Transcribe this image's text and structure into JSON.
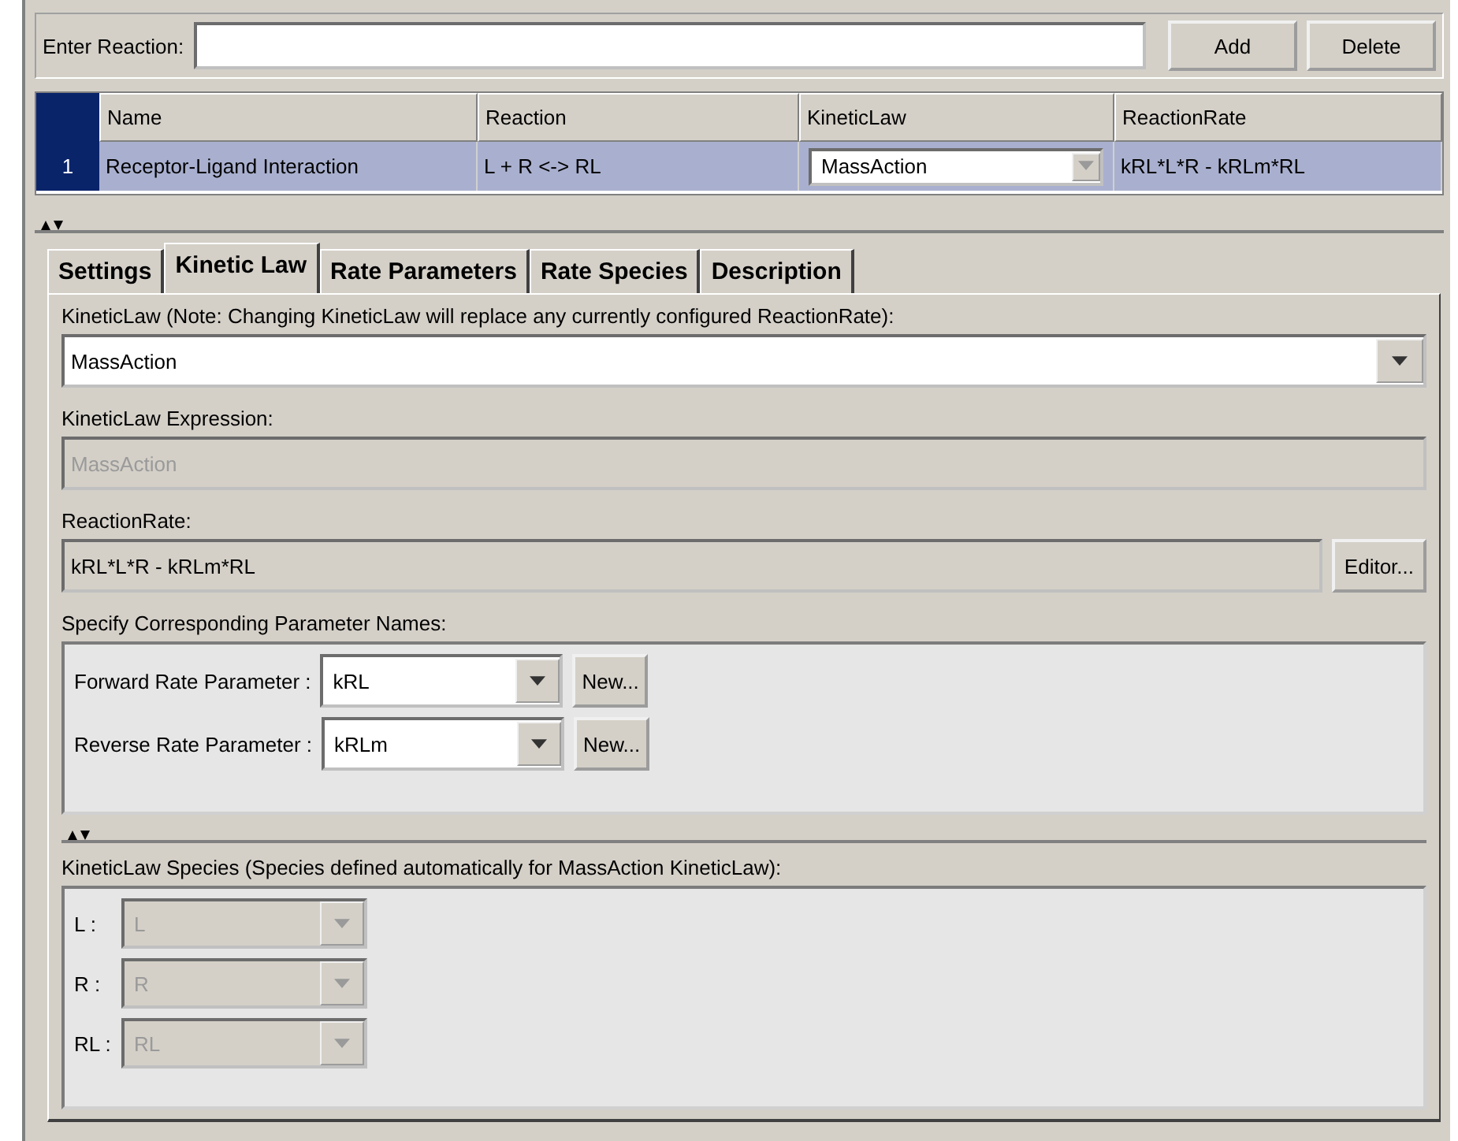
{
  "enter_reaction": {
    "label": "Enter Reaction:"
  },
  "buttons": [
    "Add",
    "Delete"
  ],
  "table": {
    "columns": [
      "Name",
      "Reaction",
      "KineticLaw",
      "ReactionRate"
    ],
    "rows": [
      {
        "index": "1",
        "selected": true,
        "name": "Receptor-Ligand Interaction",
        "reaction": "L + R <-> RL",
        "kinetic_law": "MassAction",
        "reaction_rate": "kRL*L*R - kRLm*RL"
      }
    ]
  },
  "tabs": [
    {
      "label": "Settings",
      "selected": false
    },
    {
      "label": "Kinetic Law",
      "selected": true
    },
    {
      "label": "Rate Parameters",
      "selected": false
    },
    {
      "label": "Rate Species",
      "selected": false
    },
    {
      "label": "Description",
      "selected": false
    }
  ],
  "kinetic_law": {
    "label": "KineticLaw (Note: Changing KineticLaw will replace any currently configured ReactionRate):",
    "value": "MassAction"
  },
  "expression": {
    "label": "KineticLaw Expression:",
    "value": "MassAction",
    "disabled": true
  },
  "reaction_rate": {
    "label": "ReactionRate:",
    "value": "kRL*L*R - kRLm*RL",
    "button": "Editor..."
  },
  "parameters": {
    "label": "Specify Corresponding Parameter Names:",
    "rows": [
      {
        "label": "Forward Rate Parameter :",
        "value": "kRL",
        "button": "New..."
      },
      {
        "label": "Reverse Rate Parameter :",
        "value": "kRLm",
        "button": "New..."
      }
    ]
  },
  "species": {
    "label": "KineticLaw Species (Species defined automatically for MassAction KineticLaw):",
    "rows": [
      {
        "label": "L :",
        "value": "L",
        "disabled": true
      },
      {
        "label": "R :",
        "value": "R",
        "disabled": true
      },
      {
        "label": "RL :",
        "value": "RL",
        "disabled": true
      }
    ]
  }
}
